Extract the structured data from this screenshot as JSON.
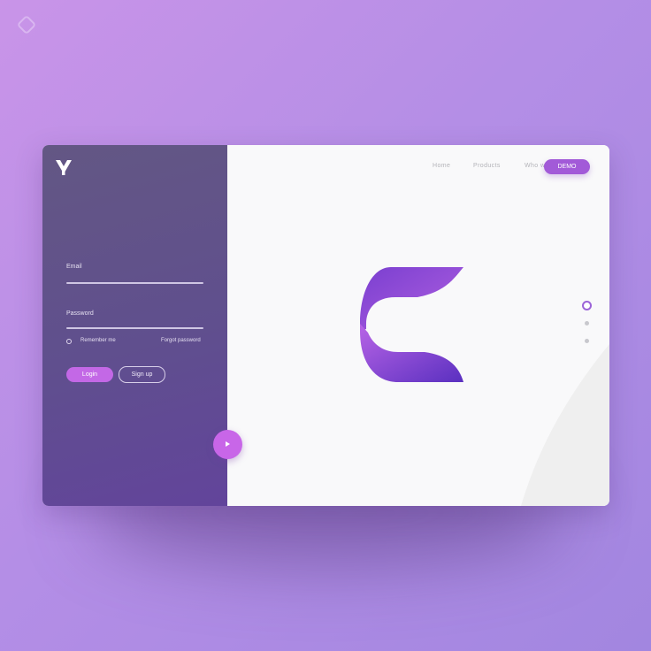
{
  "app": {
    "corner_icon": "diamond-outline-icon",
    "brand_icon": "y-logo-icon"
  },
  "login": {
    "email_label": "Email",
    "email_value": "",
    "password_label": "Password",
    "password_value": "",
    "remember_label": "Remember me",
    "forgot_label": "Forgot password",
    "login_label": "Login",
    "signup_label": "Sign up",
    "next_icon": "play-arrow-icon"
  },
  "nav": {
    "items": [
      "Home",
      "Products",
      "Who we are"
    ],
    "demo_label": "DEMO"
  },
  "hero": {
    "logo_icon": "c-logo-icon"
  },
  "pager": {
    "count": 3,
    "active": 0
  },
  "colors": {
    "accent": "#c368e6",
    "demo": "#a25ad8",
    "panel": "#604f8e",
    "background": "#b48ee6"
  }
}
